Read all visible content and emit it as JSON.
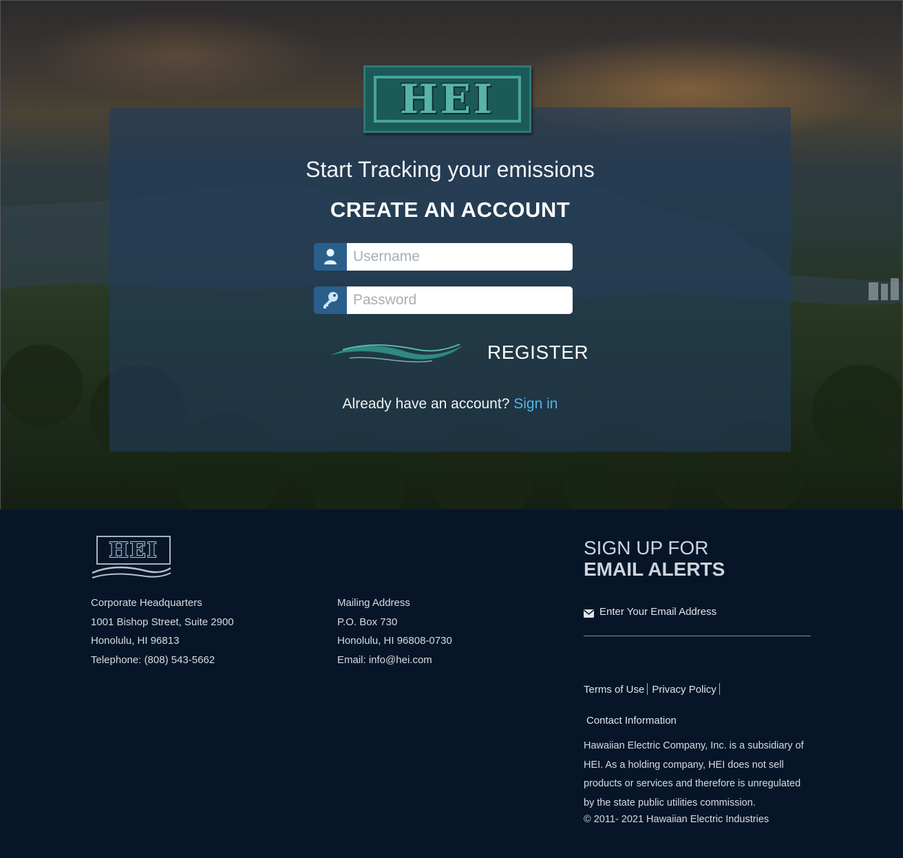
{
  "brand": {
    "logo_text": "HEI",
    "accent_color": "#58b3a8"
  },
  "hero": {
    "tagline": "Start Tracking your emissions",
    "heading": "CREATE AN ACCOUNT",
    "username": {
      "placeholder": "Username",
      "icon": "user-icon"
    },
    "password": {
      "placeholder": "Password",
      "icon": "key-icon"
    },
    "register_label": "REGISTER",
    "already_text": "Already have an account?",
    "signin_label": "Sign in",
    "link_color": "#4fb6e6"
  },
  "footer": {
    "logo_text": "HEI",
    "headquarters": {
      "title": "Corporate Headquarters",
      "line1": "1001 Bishop Street, Suite 2900",
      "line2": "Honolulu, HI 96813",
      "phone": "Telephone: (808) 543-5662"
    },
    "mailing": {
      "title": "Mailing Address",
      "line1": "P.O. Box 730",
      "line2": "Honolulu, HI 96808-0730",
      "email": "Email: info@hei.com"
    },
    "signup": {
      "line1": "SIGN UP FOR",
      "line2": "EMAIL ALERTS",
      "email_placeholder": "Enter Your Email Address",
      "icon": "envelope-icon"
    },
    "links": {
      "terms": "Terms of Use",
      "privacy": "Privacy Policy",
      "contact": "Contact Information"
    },
    "about": "Hawaiian Electric Company, Inc. is a subsidiary of HEI. As a holding company, HEI does not sell products or services and therefore is unregulated by the state public utilities commission.",
    "copyright": "© 2011- 2021 Hawaiian Electric Industries"
  }
}
